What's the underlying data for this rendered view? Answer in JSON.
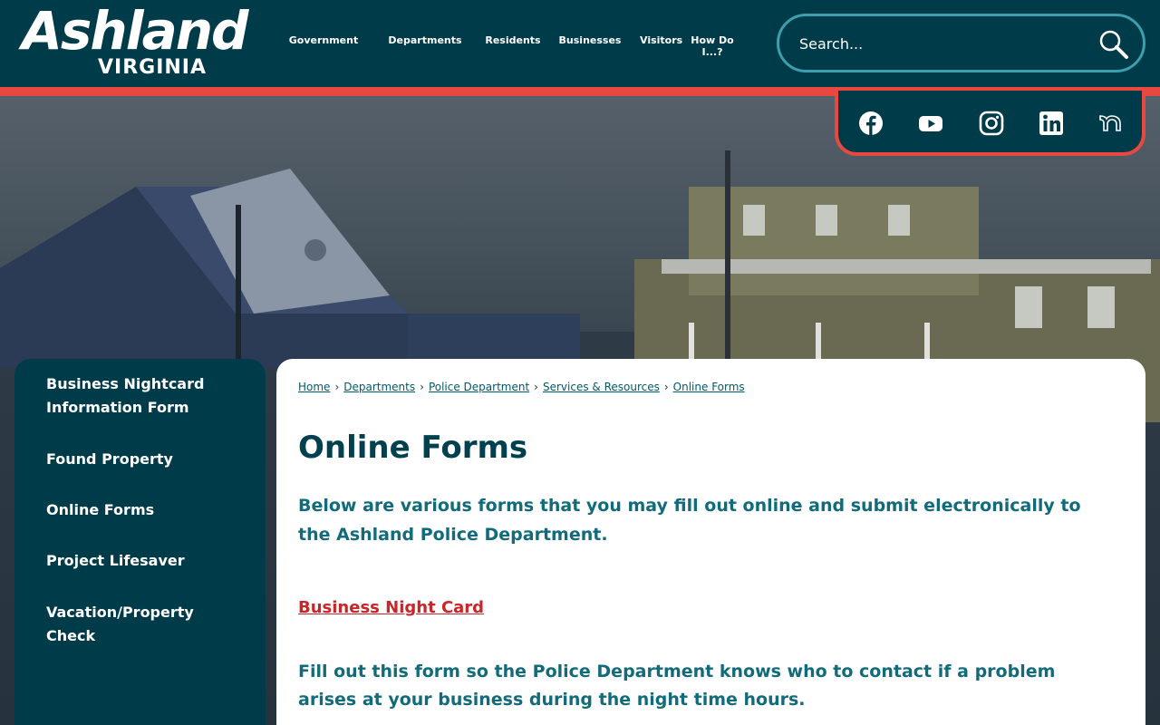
{
  "header": {
    "logo": {
      "name": "Ashland",
      "subtitle": "VIRGINIA"
    },
    "nav": [
      "Government",
      "Departments",
      "Residents",
      "Businesses",
      "Visitors",
      "How Do I...?"
    ],
    "search": {
      "placeholder": "Search..."
    }
  },
  "social": [
    "facebook-icon",
    "youtube-icon",
    "instagram-icon",
    "linkedin-icon",
    "nextdoor-icon"
  ],
  "colors": {
    "header_bg": "#003b4a",
    "accent_red": "#e8483f",
    "link_teal": "#005a6a",
    "heading": "#00404f",
    "body_text": "#116b7b",
    "form_link": "#c8262a"
  },
  "sidebar": {
    "items": [
      "Business Nightcard Information Form",
      "Found Property",
      "Online Forms",
      "Project Lifesaver",
      "Vacation/Property Check"
    ]
  },
  "main": {
    "breadcrumb": [
      "Home",
      "Departments",
      "Police Department",
      "Services & Resources",
      "Online Forms"
    ],
    "title": "Online Forms",
    "intro": "Below are various forms that you may fill out online and submit electronically to the Ashland Police Department.",
    "form_link": "Business Night Card",
    "form_desc": "Fill out this form so the Police Department knows who to contact if a problem arises at your business during the night time hours."
  }
}
